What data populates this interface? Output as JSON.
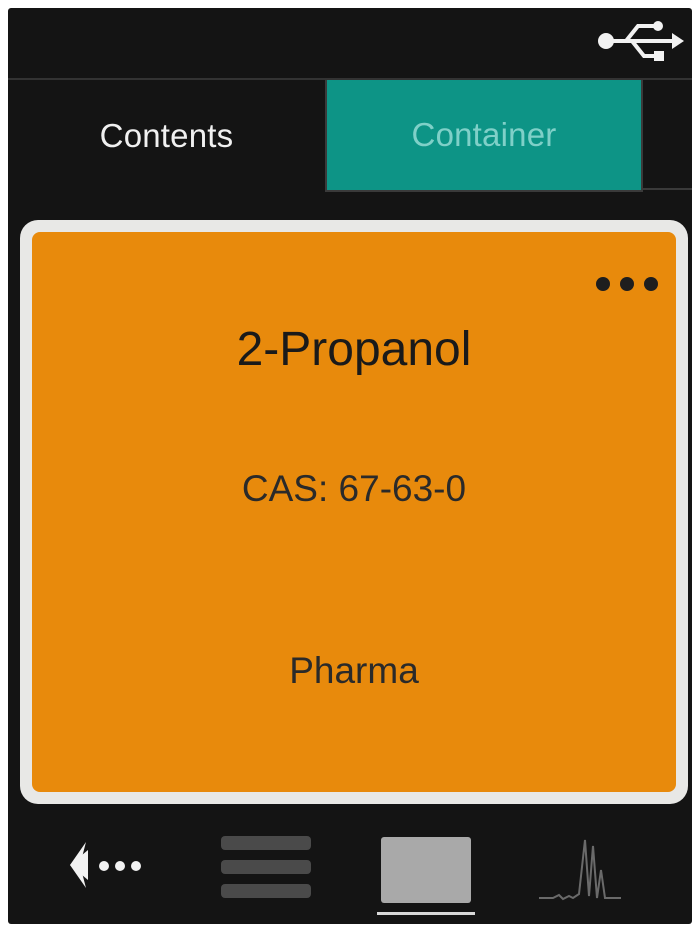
{
  "tabs": [
    {
      "label": "Contents",
      "active": true
    },
    {
      "label": "Container",
      "active": false
    }
  ],
  "card": {
    "name": "2-Propanol",
    "cas": "CAS: 67-63-0",
    "category": "Pharma",
    "color": "#e88a0c"
  },
  "icons": {
    "status": "usb-icon",
    "card_menu": "more-dots-icon",
    "nav": [
      "back-arrow-icon",
      "list-view-icon",
      "card-view-icon",
      "spectrum-icon"
    ]
  },
  "colors": {
    "background": "#141414",
    "tab_inactive": "#0d9486",
    "tab_inactive_text": "#7fd0c8",
    "accent_frame": "#e8e8e6"
  },
  "nav": {
    "active_view": "card"
  }
}
